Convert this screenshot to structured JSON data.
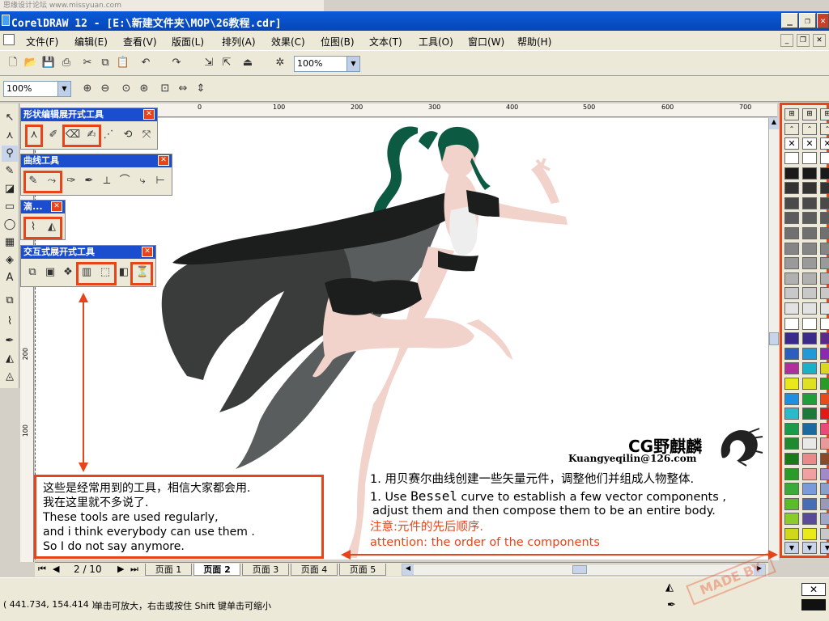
{
  "watermark": "思缘设计论坛 www.missyuan.com",
  "window": {
    "title": "CorelDRAW 12 - [E:\\新建文件夹\\MOP\\26教程.cdr]"
  },
  "menu": [
    "文件(F)",
    "编辑(E)",
    "查看(V)",
    "版面(L)",
    "排列(A)",
    "效果(C)",
    "位图(B)",
    "文本(T)",
    "工具(O)",
    "窗口(W)",
    "帮助(H)"
  ],
  "toolbar": {
    "zoom1": "100%",
    "zoom2": "100%"
  },
  "ruler": {
    "top": [
      "0",
      "100",
      "200",
      "300",
      "400",
      "500",
      "600",
      "700"
    ],
    "left": [
      "200",
      "100"
    ]
  },
  "flyouts": {
    "shape": {
      "title": "形状编辑展开式工具"
    },
    "curve": {
      "title": "曲线工具"
    },
    "drop": {
      "title": "滴..."
    },
    "interactive": {
      "title": "交互式展开式工具"
    }
  },
  "annotation_box": {
    "line1": "这些是经常用到的工具，相信大家都会用.",
    "line2": "我在这里就不多说了.",
    "line3": "These tools are used regularly,",
    "line4": "and i think everybody can use them .",
    "line5": "So I do not say anymore."
  },
  "caption": {
    "cn1": "1. 用贝赛尔曲线创建一些矢量元件，调整他们并组成人物整体.",
    "en1a": "1. Use ",
    "en1b": "Bessel",
    "en1c": " curve to establish a few vector components ,",
    "en2": "adjust them and  then compose them to be an entire body.",
    "note_cn": "注意:元件的先后顺序.",
    "note_en": "attention: the order of the components"
  },
  "logo": {
    "cg": "CG野麒麟",
    "site": "Kuangyeqilin@126.com"
  },
  "pages": {
    "counter": "2 / 10",
    "tabs": [
      "页面 1",
      "页面 2",
      "页面 3",
      "页面 4",
      "页面 5"
    ],
    "active": "页面 2"
  },
  "status": {
    "coords": "( 441.734, 154.414 )",
    "hint": "单击可放大，右击或按住 Shift 键单击可缩小"
  },
  "stamp": "MADE BY",
  "colors": {
    "accent": "#e8441a",
    "titlebar": "#0a5ad8",
    "hair": "#0d5a42",
    "cape": "#2f3131",
    "skin": "#f2d3cc"
  },
  "palette": [
    [
      "#ffffff",
      "#ffffff",
      "#ffffff"
    ],
    [
      "#1a1a1a",
      "#1a1a1a",
      "#1a1a1a"
    ],
    [
      "#333333",
      "#333333",
      "#333333"
    ],
    [
      "#4a4a4a",
      "#4a4a4a",
      "#4a4a4a"
    ],
    [
      "#5c5c5c",
      "#5c5c5c",
      "#5c5c5c"
    ],
    [
      "#707070",
      "#707070",
      "#707070"
    ],
    [
      "#858585",
      "#858585",
      "#858585"
    ],
    [
      "#9a9a9a",
      "#9a9a9a",
      "#9a9a9a"
    ],
    [
      "#b0b0b0",
      "#b0b0b0",
      "#b0b0b0"
    ],
    [
      "#c8c8c8",
      "#c8c8c8",
      "#c8c8c8"
    ],
    [
      "#e2e2e2",
      "#e2e2e2",
      "#e2e2e2"
    ],
    [
      "#ffffff",
      "#ffffff",
      "#ffffff"
    ],
    [
      "#3a2a8a",
      "#3a2a8a",
      "#5a2a8a"
    ],
    [
      "#2a5fbf",
      "#1f9ad6",
      "#8a2ab0"
    ],
    [
      "#b0309a",
      "#19b0c8",
      "#d8d81e"
    ],
    [
      "#e8e81a",
      "#e0e022",
      "#2a9a2a"
    ],
    [
      "#1e8ee0",
      "#1e9f3a",
      "#e84a1a"
    ],
    [
      "#2abac8",
      "#1a7a3a",
      "#e01a1a"
    ],
    [
      "#1a9a4a",
      "#1a6aa0",
      "#e84a7a"
    ],
    [
      "#1f8a2f",
      "#e8e8e8",
      "#e89a9a"
    ],
    [
      "#1a7a1a",
      "#ea8a8a",
      "#8a4a2a"
    ],
    [
      "#2a9a2a",
      "#f0a0a0",
      "#a08aca"
    ],
    [
      "#3aaa3a",
      "#7a9ada",
      "#8aa0ca"
    ],
    [
      "#5abc2a",
      "#4a6aba",
      "#9a9ab8"
    ],
    [
      "#8acc2a",
      "#5a4a9a",
      "#a0a8c8"
    ],
    [
      "#d0d81a",
      "#eaea1a",
      "#c8c8c8"
    ]
  ]
}
